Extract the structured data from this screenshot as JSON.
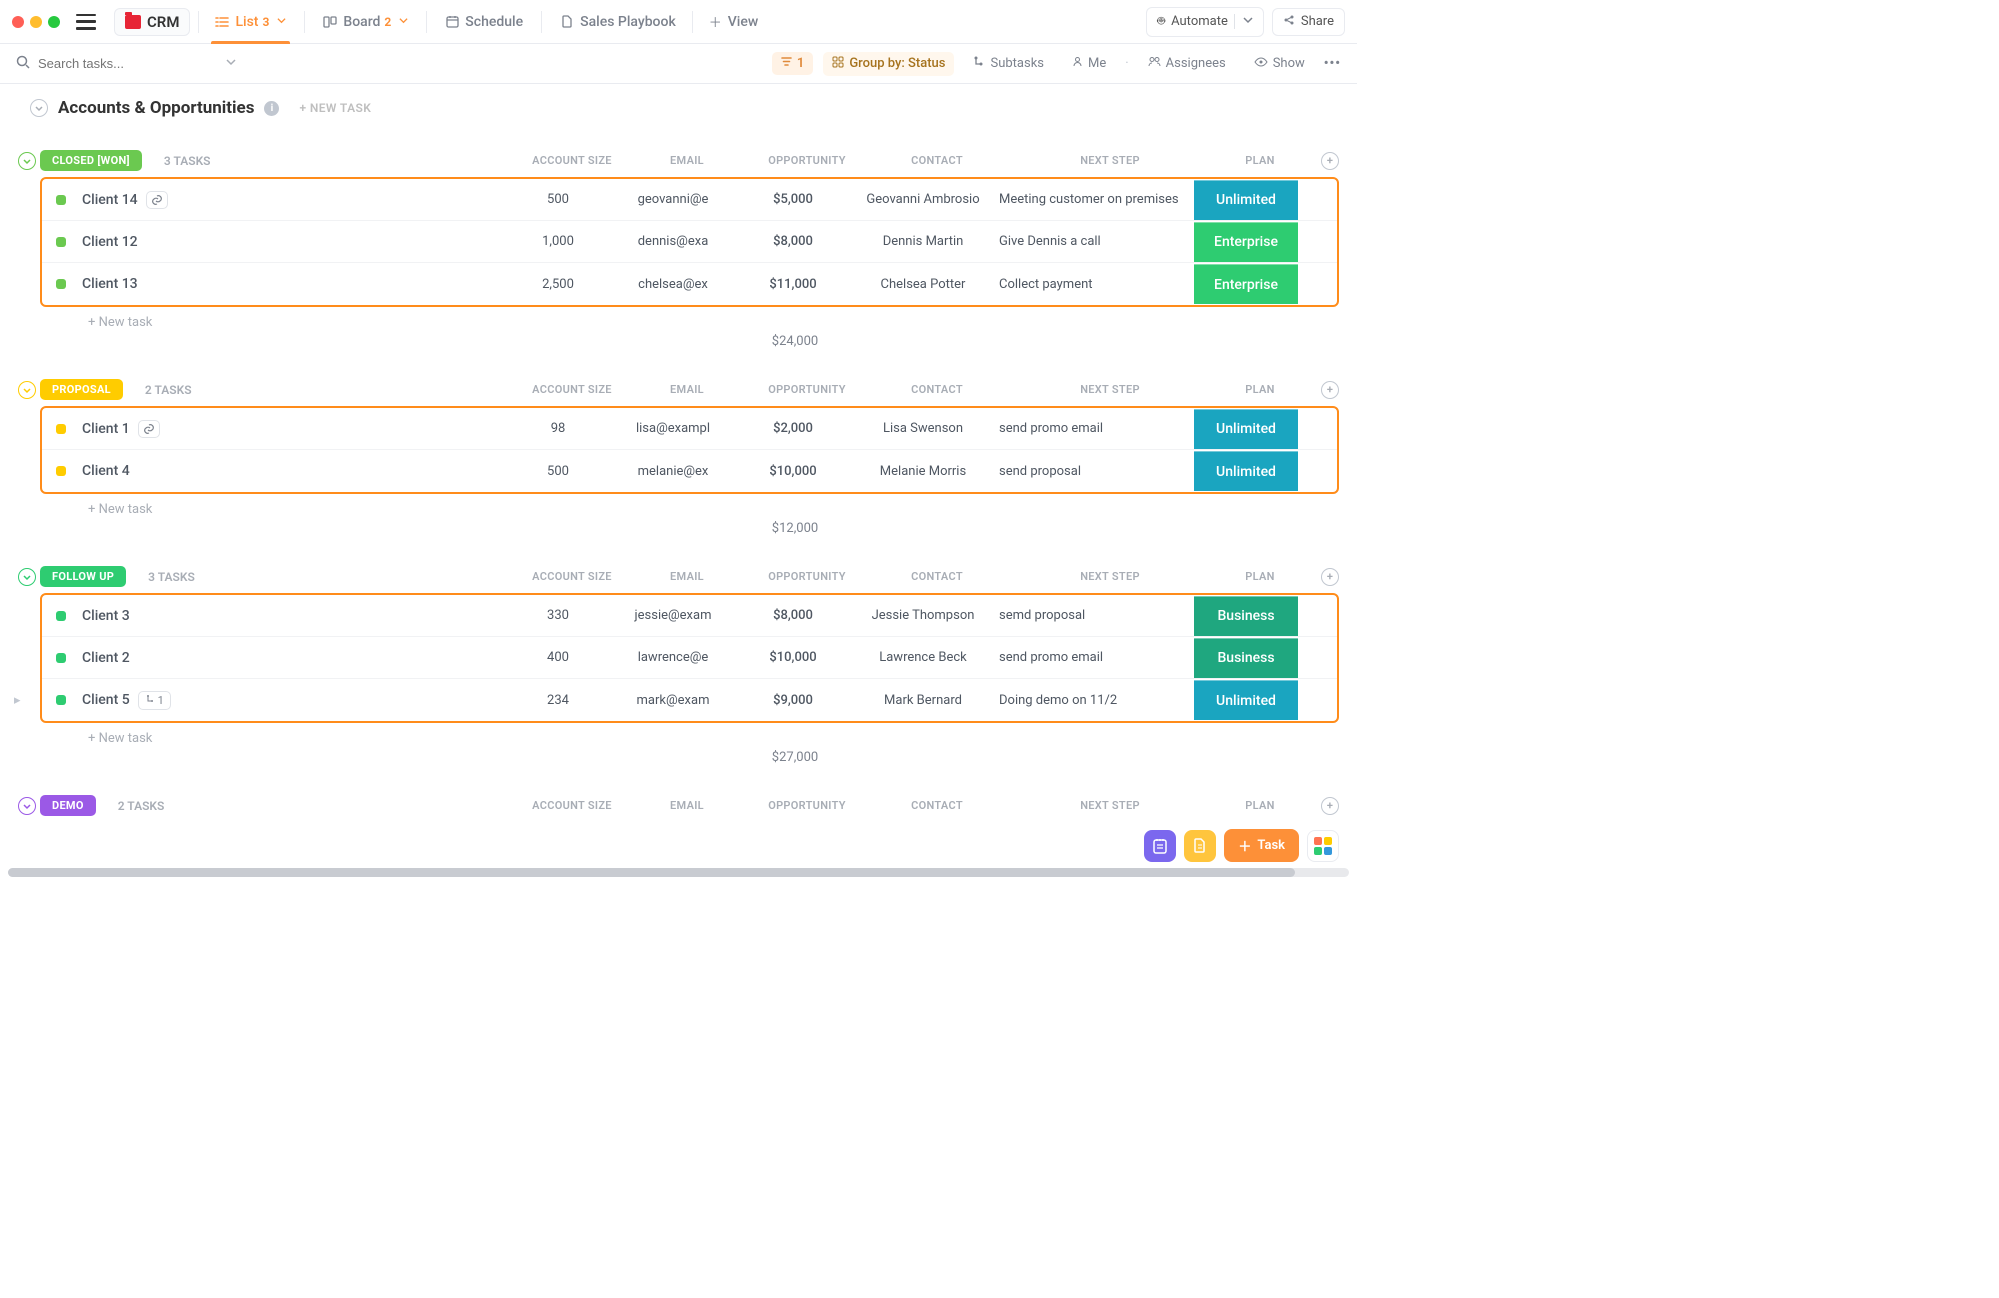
{
  "topbar": {
    "space_name": "CRM",
    "views": [
      {
        "label": "List",
        "count": "3",
        "active": true,
        "icon": "list"
      },
      {
        "label": "Board",
        "count": "2",
        "active": false,
        "icon": "board"
      },
      {
        "label": "Schedule",
        "count": "",
        "active": false,
        "icon": "calendar"
      },
      {
        "label": "Sales Playbook",
        "count": "",
        "active": false,
        "icon": "doc"
      }
    ],
    "add_view": "View",
    "automate": "Automate",
    "share": "Share"
  },
  "filterbar": {
    "search_placeholder": "Search tasks...",
    "filter_count": "1",
    "group_by": "Group by: Status",
    "subtasks": "Subtasks",
    "me": "Me",
    "assignees": "Assignees",
    "show": "Show"
  },
  "list": {
    "title": "Accounts & Opportunities",
    "new_task_top": "+ NEW TASK",
    "columns": {
      "acct": "ACCOUNT SIZE",
      "email": "EMAIL",
      "opp": "OPPORTUNITY",
      "contact": "CONTACT",
      "step": "NEXT STEP",
      "plan": "PLAN"
    }
  },
  "groups": [
    {
      "status": "CLOSED [WON]",
      "color": "#6bc950",
      "count_label": "3 TASKS",
      "sum": "$24,000",
      "rows": [
        {
          "name": "Client 14",
          "link": true,
          "sq": "#6bc950",
          "acct": "500",
          "email": "geovanni@e",
          "opp": "$5,000",
          "contact": "Geovanni Ambrosio",
          "step": "Meeting customer on premises",
          "plan": "Unlimited",
          "plan_color": "#1aa5c0"
        },
        {
          "name": "Client 12",
          "sq": "#6bc950",
          "acct": "1,000",
          "email": "dennis@exa",
          "opp": "$8,000",
          "contact": "Dennis Martin",
          "step": "Give Dennis a call",
          "plan": "Enterprise",
          "plan_color": "#2ecc71"
        },
        {
          "name": "Client 13",
          "sq": "#6bc950",
          "acct": "2,500",
          "email": "chelsea@ex",
          "opp": "$11,000",
          "contact": "Chelsea Potter",
          "step": "Collect payment",
          "plan": "Enterprise",
          "plan_color": "#2ecc71"
        }
      ]
    },
    {
      "status": "PROPOSAL",
      "color": "#ffcc00",
      "count_label": "2 TASKS",
      "sum": "$12,000",
      "rows": [
        {
          "name": "Client 1",
          "link": true,
          "sq": "#ffcc00",
          "acct": "98",
          "email": "lisa@exampl",
          "opp": "$2,000",
          "contact": "Lisa Swenson",
          "step": "send promo email",
          "plan": "Unlimited",
          "plan_color": "#1aa5c0"
        },
        {
          "name": "Client 4",
          "sq": "#ffcc00",
          "acct": "500",
          "email": "melanie@ex",
          "opp": "$10,000",
          "contact": "Melanie Morris",
          "step": "send proposal",
          "plan": "Unlimited",
          "plan_color": "#1aa5c0"
        }
      ]
    },
    {
      "status": "FOLLOW UP",
      "color": "#2ecc71",
      "count_label": "3 TASKS",
      "sum": "$27,000",
      "rows": [
        {
          "name": "Client 3",
          "sq": "#2ecc71",
          "acct": "330",
          "email": "jessie@exam",
          "opp": "$8,000",
          "contact": "Jessie Thompson",
          "step": "semd proposal",
          "plan": "Business",
          "plan_color": "#1fa77f"
        },
        {
          "name": "Client 2",
          "sq": "#2ecc71",
          "acct": "400",
          "email": "lawrence@e",
          "opp": "$10,000",
          "contact": "Lawrence Beck",
          "step": "send promo email",
          "plan": "Business",
          "plan_color": "#1fa77f"
        },
        {
          "name": "Client 5",
          "subtask": "1",
          "sq": "#2ecc71",
          "acct": "234",
          "email": "mark@exam",
          "opp": "$9,000",
          "contact": "Mark Bernard",
          "step": "Doing demo on 11/2",
          "plan": "Unlimited",
          "plan_color": "#1aa5c0"
        }
      ]
    },
    {
      "status": "DEMO",
      "color": "#9b59e6",
      "count_label": "2 TASKS",
      "sum": "",
      "rows": []
    }
  ],
  "new_task": "+ New task",
  "float": {
    "task": "Task"
  }
}
